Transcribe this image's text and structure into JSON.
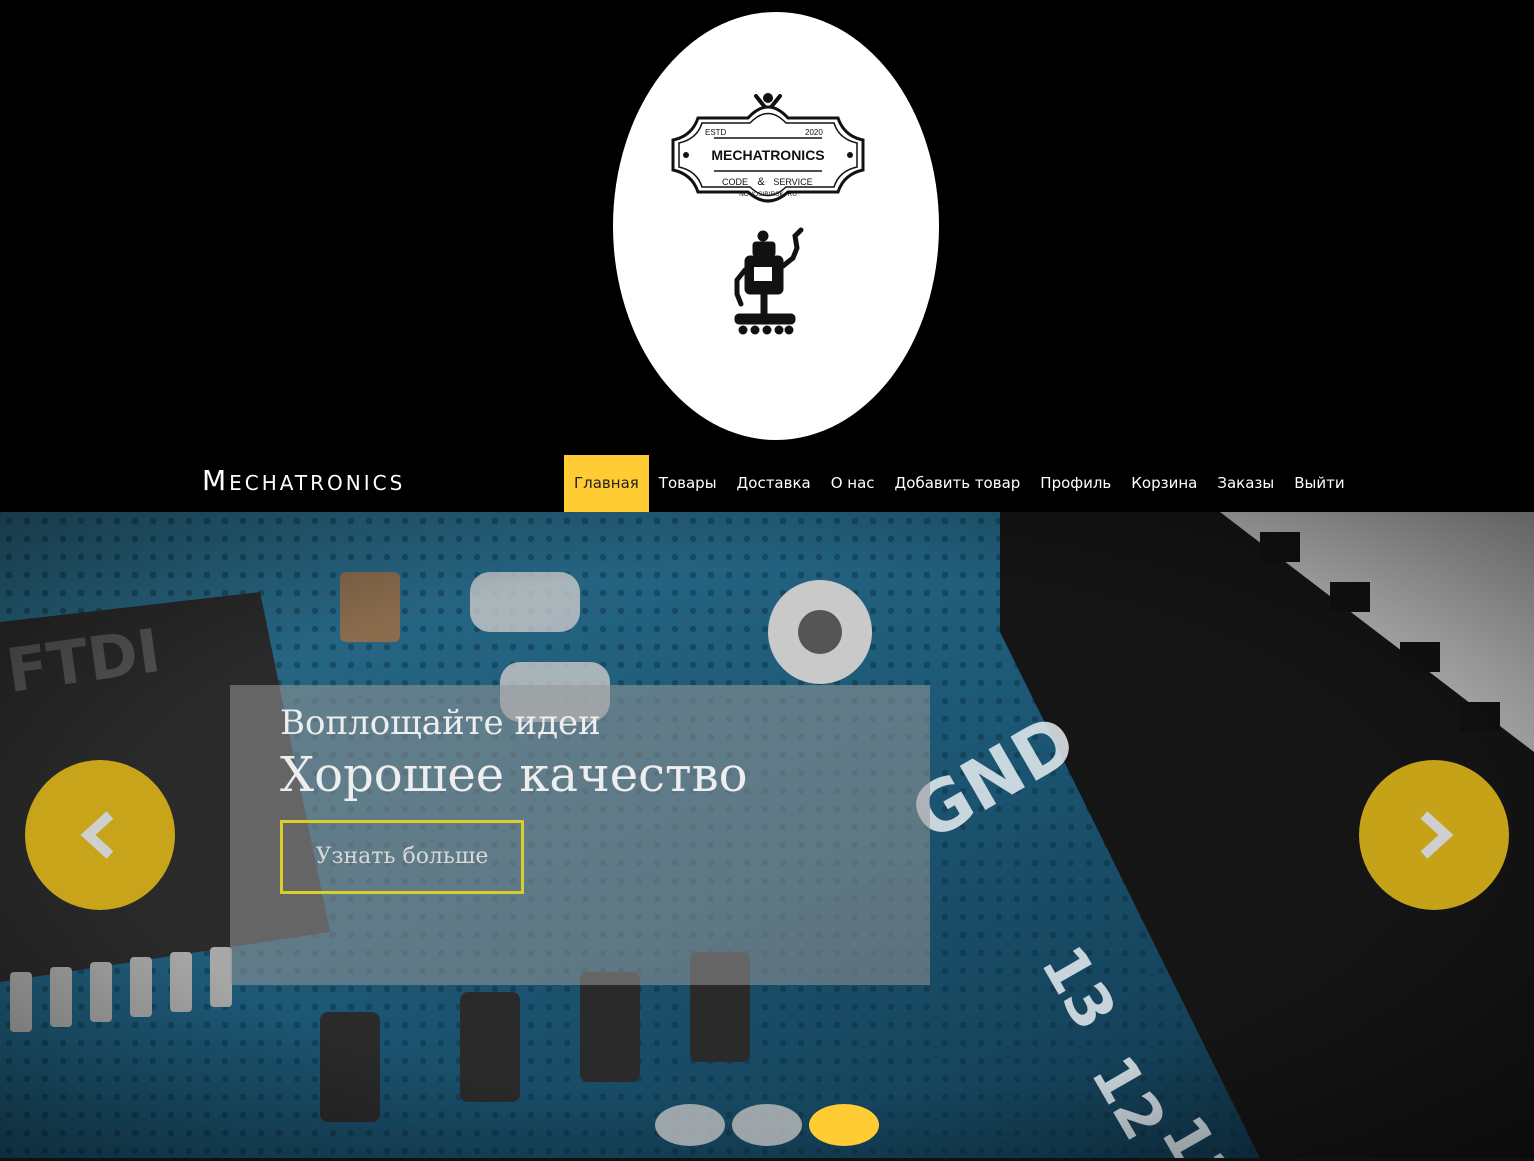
{
  "header": {
    "logo": {
      "estd": "ESTD",
      "year": "2020",
      "name": "MECHATRONICS",
      "line_left": "CODE",
      "amp": "&",
      "line_right": "SERVICE",
      "city": "NOVOSIBIRSK, RU",
      "icon": "robot-icon"
    }
  },
  "navbar": {
    "brand": "Mechatronics",
    "items": [
      {
        "label": "Главная",
        "active": true
      },
      {
        "label": "Товары"
      },
      {
        "label": "Доставка"
      },
      {
        "label": "О нас"
      },
      {
        "label": "Добавить товар"
      },
      {
        "label": "Профиль"
      },
      {
        "label": "Корзина"
      },
      {
        "label": "Заказы"
      },
      {
        "label": "Выйти"
      }
    ],
    "accent": "#ffcc33"
  },
  "carousel": {
    "caption_small": "Воплощайте идеи",
    "caption_big": "Хорошее качество",
    "button_label": "Узнать больше",
    "prev_icon": "chevron-left-icon",
    "next_icon": "chevron-right-icon",
    "slide_count": 3,
    "active_slide": 3,
    "arrow_color": "#d6af19"
  }
}
